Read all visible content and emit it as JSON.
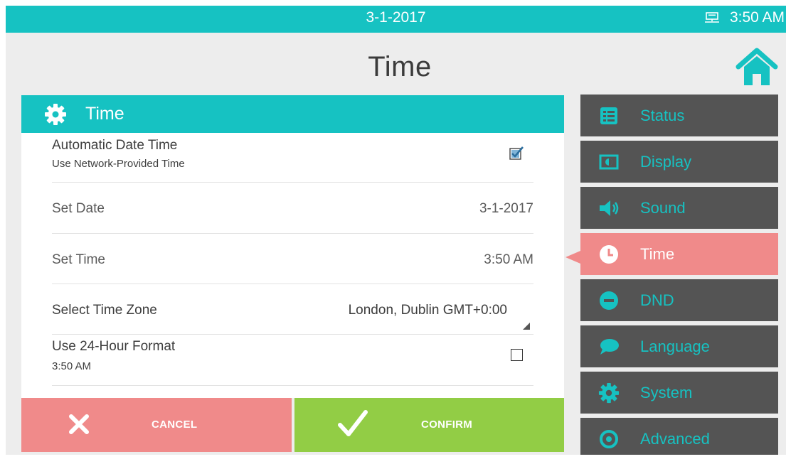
{
  "status_bar": {
    "date": "3-1-2017",
    "time": "3:50 AM"
  },
  "page_title": "Time",
  "panel": {
    "title": "Time",
    "rows": [
      {
        "label": "Automatic Date Time",
        "sublabel": "Use Network-Provided Time",
        "checked": true
      },
      {
        "label": "Set Date",
        "value": "3-1-2017"
      },
      {
        "label": "Set Time",
        "value": "3:50 AM"
      },
      {
        "label": "Select Time Zone",
        "value": "London, Dublin GMT+0:00"
      },
      {
        "label": "Use 24-Hour Format",
        "sublabel": "3:50 AM",
        "checked": false
      }
    ]
  },
  "buttons": {
    "cancel": "CANCEL",
    "confirm": "CONFIRM"
  },
  "nav": [
    {
      "label": "Status",
      "icon": "status-list-icon"
    },
    {
      "label": "Display",
      "icon": "display-icon"
    },
    {
      "label": "Sound",
      "icon": "speaker-icon"
    },
    {
      "label": "Time",
      "icon": "clock-icon",
      "active": true
    },
    {
      "label": "DND",
      "icon": "do-not-disturb-icon"
    },
    {
      "label": "Language",
      "icon": "speech-bubble-icon"
    },
    {
      "label": "System",
      "icon": "gear-icon"
    },
    {
      "label": "Advanced",
      "icon": "target-icon"
    }
  ],
  "colors": {
    "accent": "#16c2c2",
    "nav_bg": "#545454",
    "active": "#f08a8a",
    "cancel": "#f08a8a",
    "confirm": "#92cd45",
    "background": "#ededed"
  }
}
